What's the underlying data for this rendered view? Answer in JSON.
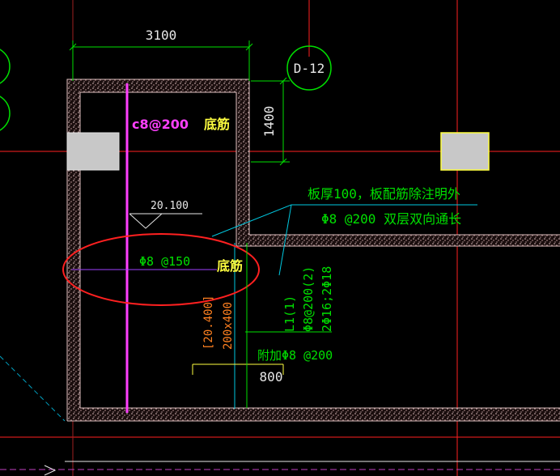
{
  "dimensions": {
    "top_width": "3100",
    "right_height": "1400",
    "bottom_width": "800"
  },
  "grid_bubble": {
    "label": "D-12"
  },
  "elevation": {
    "value": "20.100"
  },
  "notes": {
    "slab_line1": "板厚100，板配筋除注明外",
    "slab_line2": "Φ8 @200 双层双向通长",
    "bottom_bar": "Φ8 @150",
    "additional": "附加Φ8 @200"
  },
  "beam": {
    "elev": "[20.400]",
    "size": "200x400",
    "name": "L1(1)",
    "stirrup": "Φ8@200(2)",
    "bars": "2Φ16;2Φ18"
  },
  "annotations": {
    "magenta_label": "c8@200",
    "bottom_rebar_1": "底筋",
    "bottom_rebar_2": "底筋"
  },
  "colors": {
    "background": "#000000",
    "wall": "#c8a0a0",
    "grid_axis": "#ff2020",
    "dimension": "#00e000",
    "leader": "#00c8e0",
    "magenta": "#ff40ff",
    "annotation_yellow": "#ffff40",
    "highlight_ellipse": "#ff2020",
    "column": "#c8c8c8"
  }
}
